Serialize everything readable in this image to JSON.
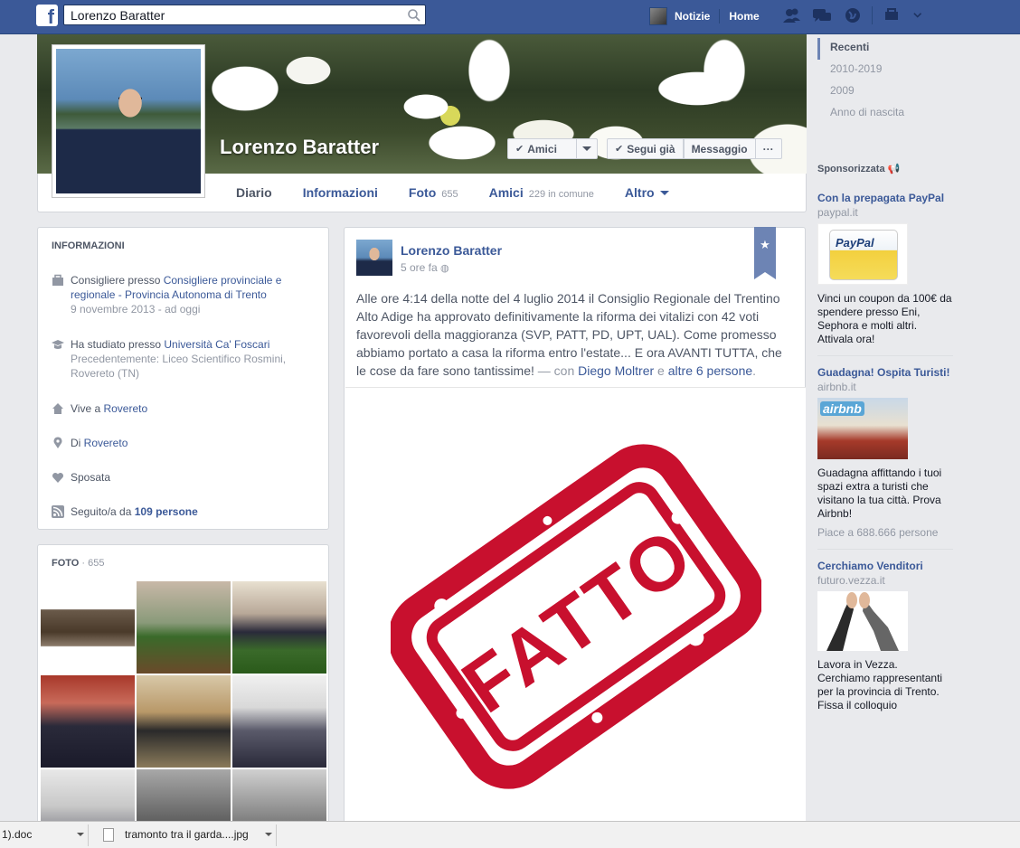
{
  "search": {
    "value": "Lorenzo Baratter"
  },
  "topnav": {
    "news": "Notizie",
    "home": "Home"
  },
  "profile": {
    "name": "Lorenzo Baratter",
    "buttons": {
      "friends": "Amici",
      "following": "Segui già",
      "message": "Messaggio",
      "more": "···"
    }
  },
  "tabs": [
    {
      "label": "Diario"
    },
    {
      "label": "Informazioni"
    },
    {
      "label": "Foto",
      "count": "655"
    },
    {
      "label": "Amici",
      "count": "229 in comune"
    },
    {
      "label": "Altro"
    }
  ],
  "timeline_years": [
    "Recenti",
    "2010-2019",
    "2009",
    "Anno di nascita"
  ],
  "info": {
    "title": "INFORMAZIONI",
    "work_prefix": "Consigliere presso ",
    "work_link": "Consigliere provinciale e regionale - Provincia Autonoma di Trento",
    "work_date": "9 novembre 2013 - ad oggi",
    "study_prefix": "Ha studiato presso ",
    "study_link": "Università Ca' Foscari",
    "study_prev": "Precedentemente: Liceo Scientifico Rosmini, Rovereto (TN)",
    "lives_prefix": "Vive a ",
    "lives_link": "Rovereto",
    "from_prefix": "Di ",
    "from_link": "Rovereto",
    "relationship": "Sposata",
    "followers_prefix": "Seguito/a da ",
    "followers_link": "109 persone"
  },
  "photos": {
    "title": "FOTO",
    "count": " · 655"
  },
  "post": {
    "author": "Lorenzo Baratter",
    "time": "5 ore fa",
    "text": "Alle ore 4:14 della notte del 4 luglio 2014 il Consiglio Regionale del Trentino Alto Adige ha approvato definitivamente la riforma dei vitalizi con 42 voti favorevoli della maggioranza (SVP, PATT, PD, UPT, UAL). Come promesso abbiamo portato a casa la riforma entro l'estate... E ora AVANTI TUTTA, che le cose da fare sono tantissime!",
    "with_prefix": " — con ",
    "tag1": "Diego Moltrer",
    "and": " e ",
    "tag2": "altre 6 persone",
    "period": ".",
    "stamp_text": "FATTO"
  },
  "sponsored": {
    "title": "Sponsorizzata",
    "ads": [
      {
        "title": "Con la prepagata PayPal",
        "domain": "paypal.it",
        "body": "Vinci un coupon da 100€ da spendere presso Eni, Sephora e molti altri. Attivala ora!",
        "extra": "",
        "img_label": "PayPal"
      },
      {
        "title": "Guadagna! Ospita Turisti!",
        "domain": "airbnb.it",
        "body": "Guadagna affittando i tuoi spazi extra a turisti che visitano la tua città. Prova Airbnb!",
        "extra": "Piace a 688.666 persone",
        "img_label": "airbnb"
      },
      {
        "title": "Cerchiamo Venditori",
        "domain": "futuro.vezza.it",
        "body": "Lavora in Vezza. Cerchiamo rappresentanti per la provincia di Trento. Fissa il colloquio",
        "extra": "",
        "img_label": ""
      }
    ]
  },
  "downloads": [
    {
      "name": "1).doc"
    },
    {
      "name": "tramonto tra il garda....jpg"
    }
  ],
  "colors": {
    "fb_blue": "#3b5998",
    "stamp_red": "#c8102e"
  }
}
